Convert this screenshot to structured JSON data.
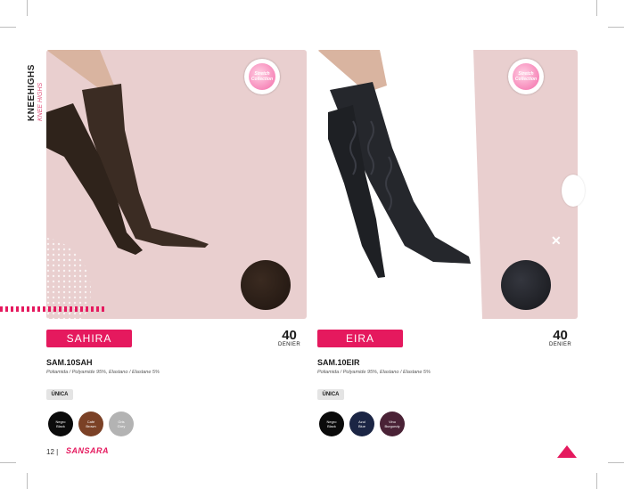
{
  "sidebar": {
    "title": "KNEEHIGHS",
    "subtitle": "KNEE HIGHS"
  },
  "products": [
    {
      "name": "SAHIRA",
      "code": "SAM.10SAH",
      "composition": "Poliamida / Polyamide 95%, Elastano / Elastane 5%",
      "denier_value": "40",
      "denier_label": "DENIER",
      "size": "ÚNICA",
      "badge": "Stretch Collection",
      "sock_color": "#3b2c23",
      "swatch_color": "#2a1d16",
      "colors": [
        {
          "label": "Negro",
          "sub": "Black",
          "hex": "#0b0b0b"
        },
        {
          "label": "Café",
          "sub": "Brown",
          "hex": "#7b4126"
        },
        {
          "label": "Gris",
          "sub": "Grey",
          "hex": "#b3b3b3"
        }
      ]
    },
    {
      "name": "EIRA",
      "code": "SAM.10EIR",
      "composition": "Poliamida / Polyamide 95%, Elastano / Elastane 5%",
      "denier_value": "40",
      "denier_label": "DENIER",
      "size": "ÚNICA",
      "badge": "Stretch Collection",
      "sock_color": "#25272c",
      "swatch_color": "#1b1c20",
      "colors": [
        {
          "label": "Negro",
          "sub": "Black",
          "hex": "#0b0b0b"
        },
        {
          "label": "Azul",
          "sub": "Blue",
          "hex": "#1b2544"
        },
        {
          "label": "Vino",
          "sub": "Burgundy",
          "hex": "#4a2236"
        }
      ]
    }
  ],
  "footer": {
    "page": "12 |",
    "brand": "SANSARA"
  },
  "colors": {
    "accent": "#e5195e",
    "panel_bg": "#e9cfcf"
  }
}
